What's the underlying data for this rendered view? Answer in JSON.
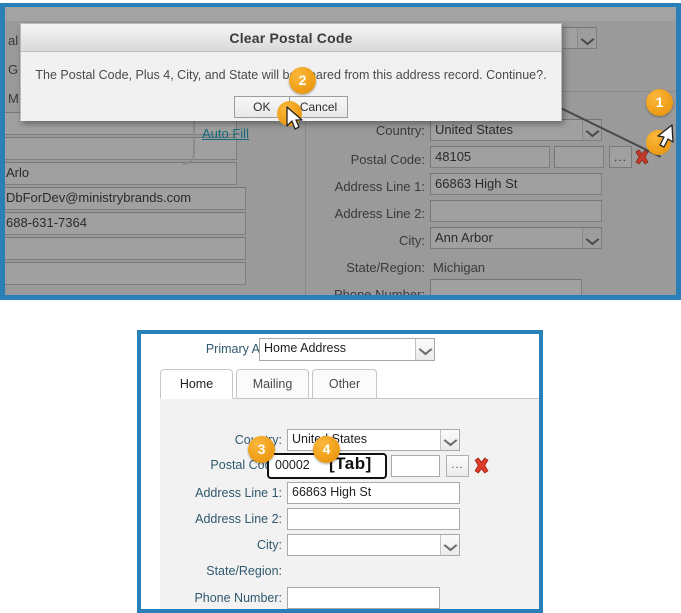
{
  "top_panel": {
    "partial_left_labels": [
      "al",
      "G",
      "M"
    ],
    "auto_fill_link": "Auto Fill",
    "left_fields": [
      {
        "value": ""
      },
      {
        "value": ""
      },
      {
        "value": "Arlo"
      },
      {
        "value": "DbForDev@ministrybrands.com"
      },
      {
        "value": "688-631-7364"
      },
      {
        "value": ""
      },
      {
        "value": ""
      }
    ],
    "address_form": {
      "rows": [
        {
          "label": "Country:",
          "value": "United States",
          "type": "combo"
        },
        {
          "label": "Postal Code:",
          "value": "48105",
          "type": "postal"
        },
        {
          "label": "Address Line 1:",
          "value": "66863 High St",
          "type": "text"
        },
        {
          "label": "Address Line 2:",
          "value": "",
          "type": "text"
        },
        {
          "label": "City:",
          "value": "Ann Arbor",
          "type": "combo"
        },
        {
          "label": "State/Region:",
          "value": "Michigan",
          "type": "static"
        },
        {
          "label": "Phone Number:",
          "value": "",
          "type": "text"
        }
      ],
      "plus4_value": "",
      "browse_button_label": "...",
      "clear_icon": "red-x-clear-icon"
    }
  },
  "dialog": {
    "title": "Clear Postal Code",
    "message": "The Postal Code, Plus 4, City, and State will be cleared from this address record. Continue?.",
    "ok_label": "OK",
    "cancel_label": "Cancel"
  },
  "bottom_panel": {
    "primary_address_label": "Primary Address:",
    "primary_address_value": "Home Address",
    "tabs": [
      {
        "label": "Home",
        "active": true
      },
      {
        "label": "Mailing",
        "active": false
      },
      {
        "label": "Other",
        "active": false
      }
    ],
    "address_form": {
      "rows": [
        {
          "label": "Country:",
          "value": "United States",
          "type": "combo"
        },
        {
          "label": "Postal Code:",
          "value": "00002",
          "type": "postal"
        },
        {
          "label": "Address Line 1:",
          "value": "66863 High St",
          "type": "text"
        },
        {
          "label": "Address Line 2:",
          "value": "",
          "type": "text"
        },
        {
          "label": "City:",
          "value": "",
          "type": "combo"
        },
        {
          "label": "State/Region:",
          "value": "",
          "type": "static"
        },
        {
          "label": "Phone Number:",
          "value": "",
          "type": "text"
        }
      ],
      "plus4_value": "",
      "browse_button_label": "...",
      "clear_icon": "red-x-clear-icon",
      "keypress_annotation": "[Tab]"
    }
  },
  "annotations": {
    "badges": [
      {
        "number": "1"
      },
      {
        "number": "2"
      },
      {
        "number": "3"
      },
      {
        "number": "4"
      }
    ]
  },
  "colors": {
    "accent_border": "#2980b9",
    "badge_orange": "#f0a01a",
    "link_teal": "#14697a",
    "label_blue": "#31596e",
    "clear_red": "#c0392b",
    "top_panel_bg": "#9a9a9a"
  }
}
